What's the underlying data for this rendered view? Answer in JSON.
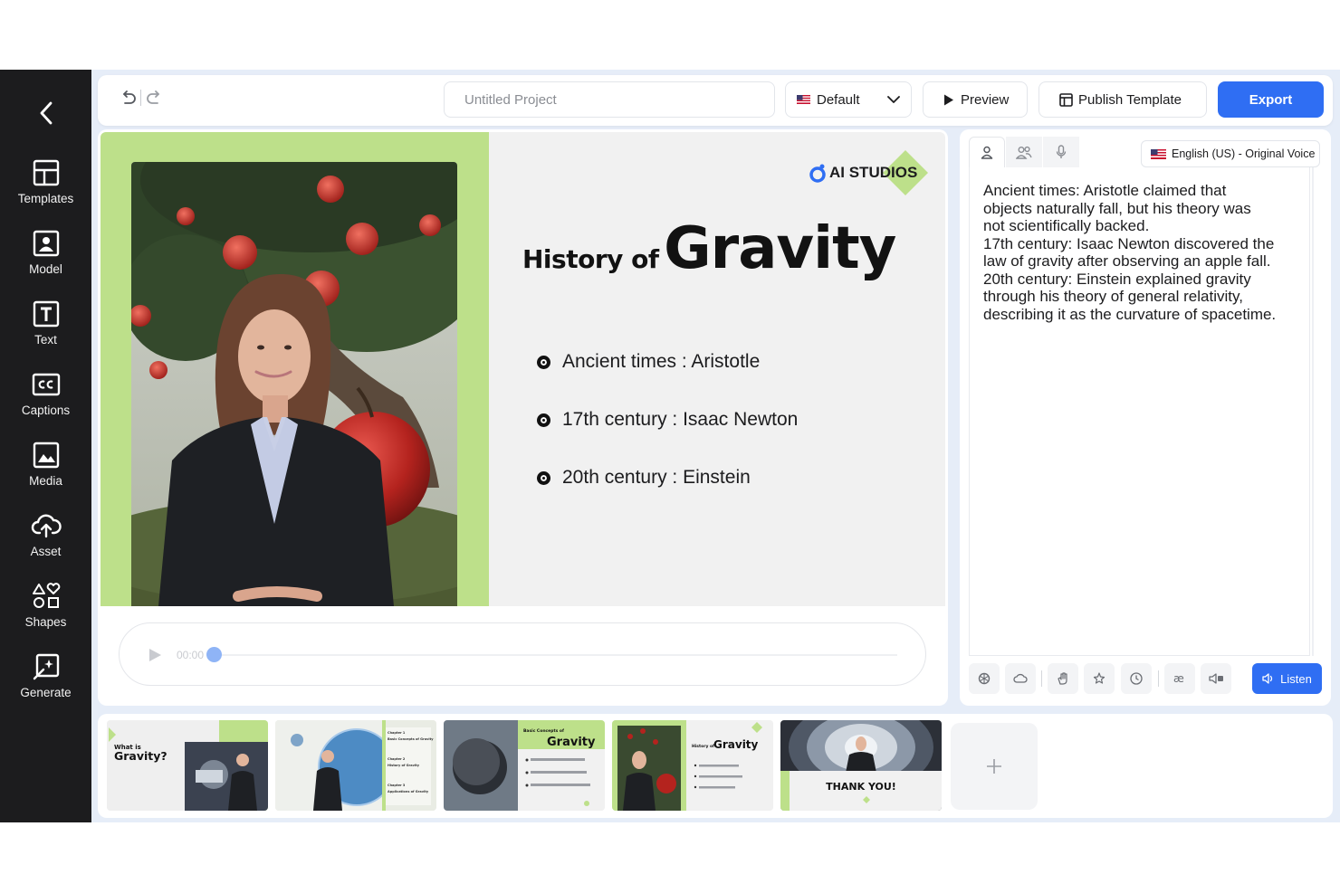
{
  "sidebar": {
    "back_label": "",
    "items": [
      {
        "label": "Templates",
        "icon": "templates-icon"
      },
      {
        "label": "Model",
        "icon": "model-icon"
      },
      {
        "label": "Text",
        "icon": "text-icon"
      },
      {
        "label": "Captions",
        "icon": "captions-icon"
      },
      {
        "label": "Media",
        "icon": "media-icon"
      },
      {
        "label": "Asset",
        "icon": "asset-icon"
      },
      {
        "label": "Shapes",
        "icon": "shapes-icon"
      },
      {
        "label": "Generate",
        "icon": "generate-icon"
      }
    ]
  },
  "toolbar": {
    "project_placeholder": "Untitled Project",
    "default_label": "Default",
    "preview_label": "Preview",
    "publish_label": "Publish Template",
    "export_label": "Export"
  },
  "slide": {
    "logo_text": "AI STUDIOS",
    "title_prefix": "History of",
    "title_main": "Gravity",
    "bullets": [
      "Ancient times : Aristotle",
      "17th century : Isaac Newton",
      "20th century : Einstein"
    ]
  },
  "player": {
    "time": "00:00",
    "progress": 0
  },
  "script": {
    "voice": "English (US) - Original Voice",
    "text": "Ancient times: Aristotle claimed that\nobjects naturally fall, but his theory was\nnot scientifically backed.\n17th century: Isaac Newton discovered the\nlaw of gravity after observing an apple fall.\n20th century: Einstein explained gravity\nthrough his theory of general relativity,\ndescribing it as the curvature of spacetime.",
    "listen_label": "Listen",
    "tools": [
      "openai-icon",
      "cloud-icon",
      "gesture-icon",
      "effect-icon",
      "clock-icon",
      "ae-icon",
      "volume-icon"
    ]
  },
  "thumbnails": [
    {
      "title_small": "What is",
      "title_big": "Gravity?"
    },
    {
      "items": [
        "Chapter 1",
        "Basic Concepts of Gravity",
        "Chapter 2",
        "History of Gravity",
        "Chapter 3",
        "Applications of Gravity"
      ]
    },
    {
      "title_small": "Basic Concepts of",
      "title_big": "Gravity"
    },
    {
      "title_small": "History of",
      "title_big": "Gravity"
    },
    {
      "title_big": "THANK YOU!"
    }
  ],
  "colors": {
    "accent": "#2f6ef3",
    "slide_green": "#bde08a",
    "sidebar_bg": "#1c1c1e"
  }
}
